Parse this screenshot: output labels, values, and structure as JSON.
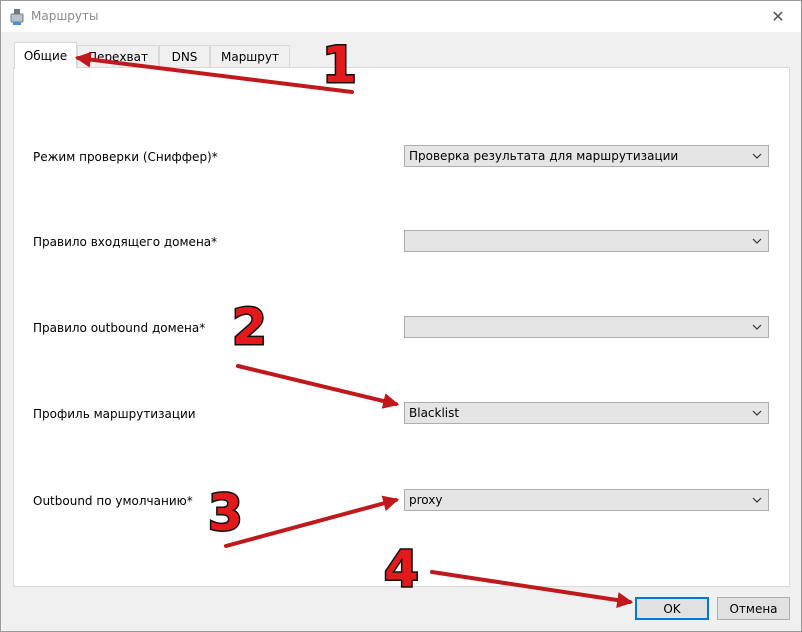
{
  "window": {
    "title": "Маршруты"
  },
  "tabs": [
    {
      "label": "Общие",
      "active": true
    },
    {
      "label": "Перехват",
      "active": false
    },
    {
      "label": "DNS",
      "active": false
    },
    {
      "label": "Маршрут",
      "active": false
    }
  ],
  "fields": [
    {
      "label": "Режим проверки (Сниффер)*",
      "value": "Проверка результата для маршрутизации"
    },
    {
      "label": "Правило входящего домена*",
      "value": ""
    },
    {
      "label": "Правило outbound домена*",
      "value": ""
    },
    {
      "label": "Профиль маршрутизации",
      "value": "Blacklist"
    },
    {
      "label": "Outbound по умолчанию*",
      "value": "proxy"
    }
  ],
  "buttons": {
    "ok": "OK",
    "cancel": "Отмена"
  },
  "annotations": {
    "step1": "1",
    "step2": "2",
    "step3": "3",
    "step4": "4",
    "color": "#e31a1c"
  },
  "icons": {
    "app": "app-icon",
    "close": "close-icon",
    "dropdown": "chevron-down-icon"
  }
}
